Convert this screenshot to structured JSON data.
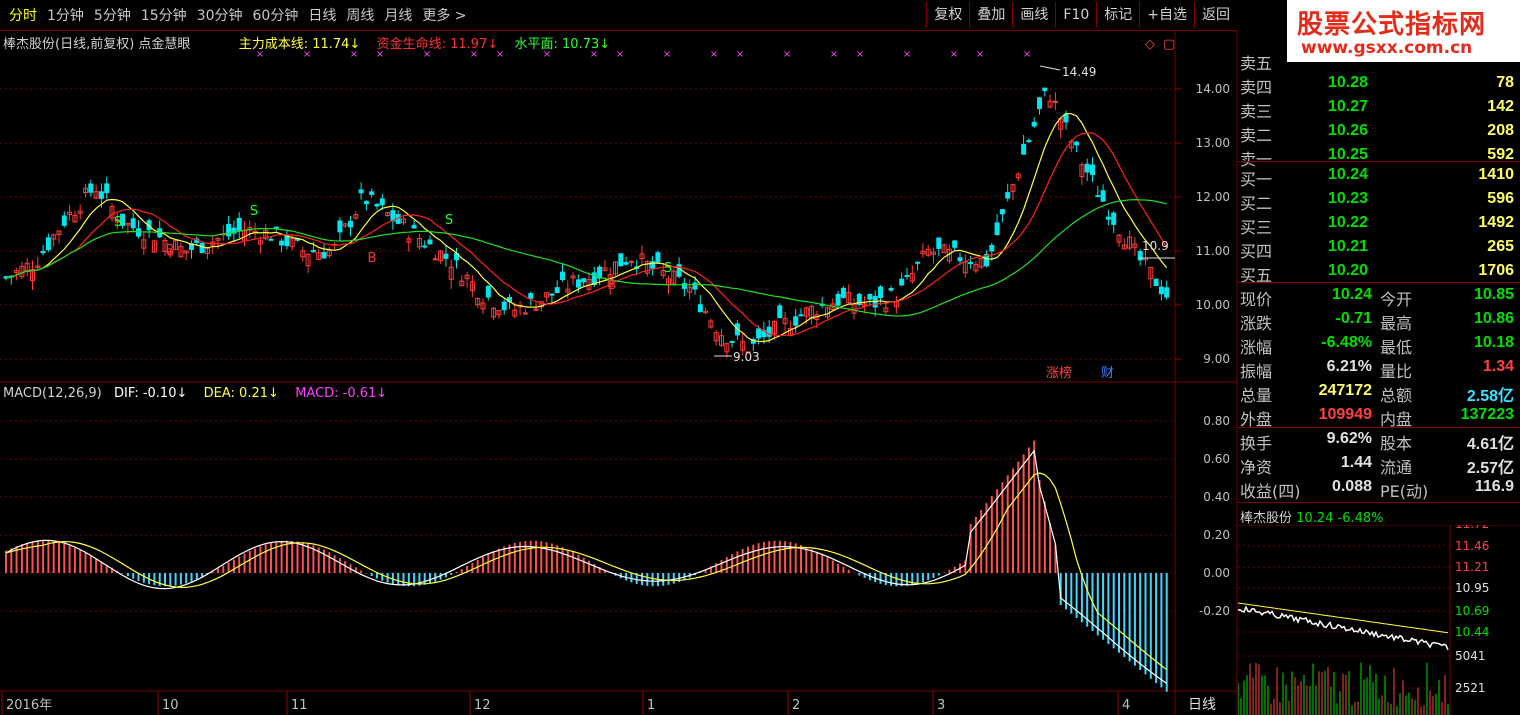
{
  "toolbar": {
    "periods": [
      "分时",
      "1分钟",
      "5分钟",
      "15分钟",
      "30分钟",
      "60分钟",
      "日线",
      "周线",
      "月线",
      "更多 >"
    ],
    "tools": [
      "复权",
      "叠加",
      "画线",
      "F10",
      "标记",
      "+自选",
      "返回"
    ]
  },
  "logo": {
    "title": "股票公式指标网",
    "url": "www.gsxx.com.cn"
  },
  "main_chart": {
    "title": "棒杰股份(日线,前复权) 点金慧眼",
    "ind1_label": "主力成本线: 11.74↓",
    "ind2_label": "资金生命线: 11.97↓",
    "ind3_label": "水平面: 10.73↓",
    "y_ticks": [
      "14.00",
      "13.00",
      "12.00",
      "11.00",
      "10.00",
      "9.00"
    ],
    "high_label": "14.49",
    "low_label": "9.03",
    "last_label": "10.9",
    "badge_zhang": "涨榜",
    "badge_cai": "财",
    "signal_s": "S",
    "signal_b": "B"
  },
  "macd_chart": {
    "title": "MACD(12,26,9)",
    "dif_label": "DIF: -0.10↓",
    "dea_label": "DEA: 0.21↓",
    "macd_label": "MACD: -0.61↓",
    "y_ticks": [
      "0.80",
      "0.60",
      "0.40",
      "0.20",
      "0.00",
      "-0.20"
    ]
  },
  "x_axis": {
    "labels": [
      "2016年",
      "10",
      "11",
      "12",
      "1",
      "2",
      "3",
      "4"
    ],
    "period_label": "日线"
  },
  "quote": {
    "ask": [
      {
        "label": "卖五",
        "price": "",
        "vol": ""
      },
      {
        "label": "卖四",
        "price": "10.28",
        "vol": "78"
      },
      {
        "label": "卖三",
        "price": "10.27",
        "vol": "142"
      },
      {
        "label": "卖二",
        "price": "10.26",
        "vol": "208"
      },
      {
        "label": "卖一",
        "price": "10.25",
        "vol": "592"
      }
    ],
    "bid": [
      {
        "label": "买一",
        "price": "10.24",
        "vol": "1410"
      },
      {
        "label": "买二",
        "price": "10.23",
        "vol": "596"
      },
      {
        "label": "买三",
        "price": "10.22",
        "vol": "1492"
      },
      {
        "label": "买四",
        "price": "10.21",
        "vol": "265"
      },
      {
        "label": "买五",
        "price": "10.20",
        "vol": "1706"
      }
    ],
    "stats1": [
      {
        "k1": "现价",
        "v1": "10.24",
        "c1": "#00e000",
        "k2": "今开",
        "v2": "10.85",
        "c2": "#00e000"
      },
      {
        "k1": "涨跌",
        "v1": "-0.71",
        "c1": "#00e000",
        "k2": "最高",
        "v2": "10.86",
        "c2": "#00e000"
      },
      {
        "k1": "涨幅",
        "v1": "-6.48%",
        "c1": "#00e000",
        "k2": "最低",
        "v2": "10.18",
        "c2": "#00e000"
      },
      {
        "k1": "振幅",
        "v1": "6.21%",
        "c1": "#e0e0e0",
        "k2": "量比",
        "v2": "1.34",
        "c2": "#ff4040"
      },
      {
        "k1": "总量",
        "v1": "247172",
        "c1": "#ffff66",
        "k2": "总额",
        "v2": "2.58亿",
        "c2": "#40e0ff"
      },
      {
        "k1": "外盘",
        "v1": "109949",
        "c1": "#ff4040",
        "k2": "内盘",
        "v2": "137223",
        "c2": "#00e000"
      }
    ],
    "stats2": [
      {
        "k1": "换手",
        "v1": "9.62%",
        "c1": "#e0e0e0",
        "k2": "股本",
        "v2": "4.61亿",
        "c2": "#e0e0e0"
      },
      {
        "k1": "净资",
        "v1": "1.44",
        "c1": "#e0e0e0",
        "k2": "流通",
        "v2": "2.57亿",
        "c2": "#e0e0e0"
      },
      {
        "k1": "收益(四)",
        "v1": "0.088",
        "c1": "#e0e0e0",
        "k2": "PE(动)",
        "v2": "116.9",
        "c2": "#e0e0e0"
      }
    ]
  },
  "mini_chart": {
    "name": "棒杰股份",
    "price": "10.24",
    "change": "-6.48%",
    "y_ticks": [
      "11.72",
      "11.46",
      "11.21",
      "10.95",
      "10.69",
      "10.44",
      "5041",
      "2521"
    ],
    "y_colors": [
      "#ff4040",
      "#ff4040",
      "#ff4040",
      "#e0e0e0",
      "#00e000",
      "#00e000",
      "#e0e0e0",
      "#e0e0e0"
    ]
  },
  "chart_data": {
    "type": "candlestick",
    "title": "棒杰股份(日线,前复权)",
    "price_ylim": [
      8.5,
      15.2
    ],
    "price_ticks": [
      9,
      10,
      11,
      12,
      13,
      14
    ],
    "price_series_approx": [
      10.5,
      10.8,
      11.6,
      12.2,
      11.5,
      11.3,
      11.0,
      11.2,
      11.4,
      11.3,
      11.0,
      11.0,
      12.0,
      11.6,
      11.2,
      10.8,
      10.2,
      9.9,
      10.1,
      10.4,
      10.6,
      10.9,
      10.6,
      10.3,
      9.5,
      9.2,
      9.6,
      9.9,
      10.1,
      10.0,
      10.2,
      11.0,
      10.9,
      10.8,
      12.5,
      14.0,
      12.8,
      11.8,
      10.9,
      10.2
    ],
    "macd_ylim": [
      -0.35,
      0.95
    ],
    "macd_ticks": [
      0.8,
      0.6,
      0.4,
      0.2,
      0.0,
      -0.2
    ],
    "dif_last": -0.1,
    "dea_last": 0.21,
    "macd_last": -0.61,
    "high": 14.49,
    "low": 9.03
  }
}
